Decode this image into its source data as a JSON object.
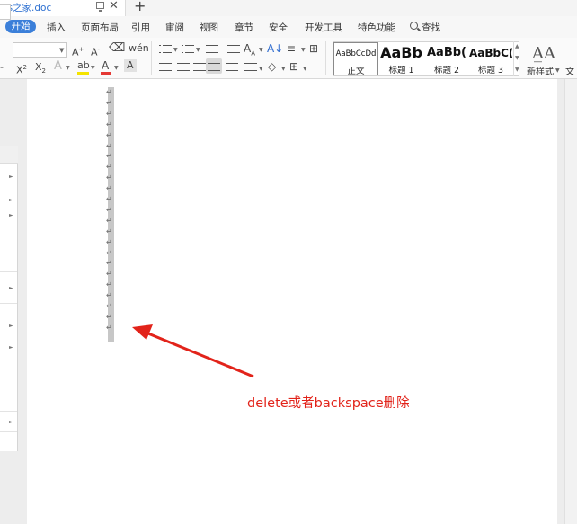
{
  "window": {
    "doc_title": "ws之家.doc",
    "new_tab_symbol": "+"
  },
  "menu": {
    "active": "开始",
    "items": [
      "插入",
      "页面布局",
      "引用",
      "审阅",
      "视图",
      "章节",
      "安全",
      "开发工具",
      "特色功能"
    ],
    "search_label": "查找"
  },
  "styles": [
    {
      "preview": "AaBbCcDd",
      "name": "正文"
    },
    {
      "preview": "AaBb",
      "name": "标题 1"
    },
    {
      "preview": "AaBb(",
      "name": "标题 2"
    },
    {
      "preview": "AaBbC(",
      "name": "标题 3"
    }
  ],
  "ribbon": {
    "new_style_label": "新样式",
    "text_cut_label": "文"
  },
  "document": {
    "annotation": "delete或者backspace删除",
    "paragraph_mark": "↵"
  },
  "colors": {
    "accent": "#3b7fd9",
    "annotation_red": "#e2231a",
    "highlight_yellow": "#f5e400",
    "font_color_red": "#e53935"
  }
}
